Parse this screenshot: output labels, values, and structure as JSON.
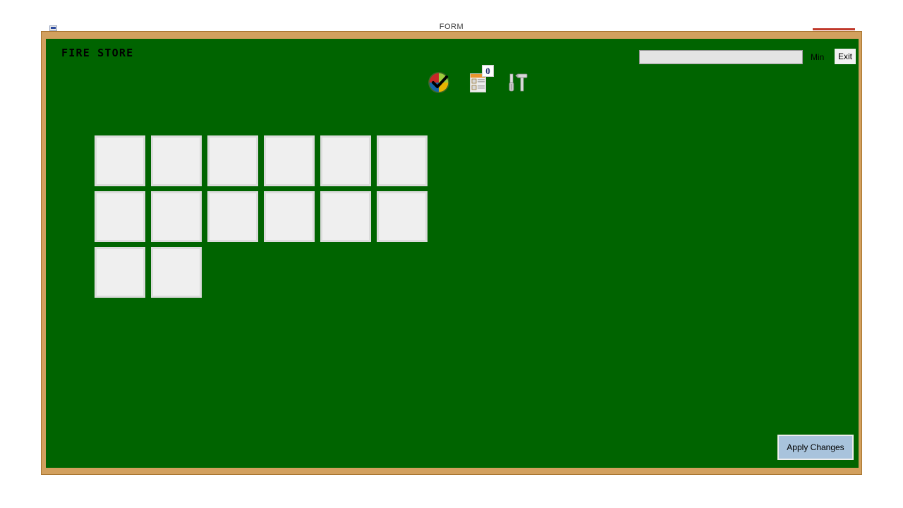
{
  "parent_window": {
    "title": "FORM",
    "icon": "app-icon"
  },
  "window": {
    "frame_color": "#d2a05e",
    "surface_color": "#006400",
    "title": "FIRE STORE"
  },
  "header": {
    "search": {
      "value": "",
      "placeholder": ""
    },
    "min_label": "Min",
    "exit_label": "Exit"
  },
  "toolbar": {
    "items": [
      {
        "name": "color-wheel-icon",
        "label": "Colours"
      },
      {
        "name": "contact-list-icon",
        "label": "Records",
        "badge": "0"
      },
      {
        "name": "tools-icon",
        "label": "Tools"
      }
    ]
  },
  "palette": {
    "swatches": [
      {
        "name": "swatch-firebrick",
        "color": "#b22222"
      },
      {
        "name": "swatch-teal",
        "color": "#008080"
      },
      {
        "name": "swatch-linen",
        "color": "#faeee3"
      },
      {
        "name": "swatch-dodger-blue",
        "color": "#1e90ff"
      },
      {
        "name": "swatch-purple",
        "color": "#9400a0"
      },
      {
        "name": "swatch-dim-gray",
        "color": "#6b6b6b"
      },
      {
        "name": "swatch-sienna",
        "color": "#9c5333"
      },
      {
        "name": "swatch-yellow",
        "color": "#ffff00"
      },
      {
        "name": "swatch-yellow-green",
        "color": "#9acd3c"
      },
      {
        "name": "swatch-indigo",
        "color": "#4b0082"
      },
      {
        "name": "swatch-dark-green",
        "color": "#006400"
      },
      {
        "name": "swatch-cornflower-blue",
        "color": "#6495ed"
      },
      {
        "name": "swatch-olive",
        "color": "#808000"
      },
      {
        "name": "swatch-dark-goldenrod",
        "color": "#b8860b"
      }
    ]
  },
  "footer": {
    "apply_label": "Apply Changes"
  }
}
